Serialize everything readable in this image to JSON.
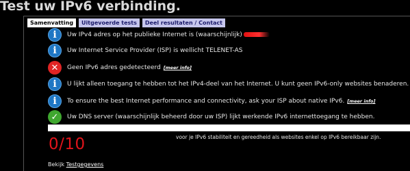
{
  "page": {
    "title": "Test uw IPv6 verbinding."
  },
  "tabs": [
    {
      "label": "Samenvatting",
      "active": true
    },
    {
      "label": "Uitgevoerde tests",
      "active": false
    },
    {
      "label": "Deel resultaten / Contact",
      "active": false
    }
  ],
  "messages": [
    {
      "icon": "info-icon",
      "text": "Uw IPv4 adres op het publieke Internet is (waarschijnlijk)"
    },
    {
      "icon": "info-icon",
      "text": "Uw Internet Service Provider (ISP) is wellicht TELENET-AS"
    },
    {
      "icon": "error-icon",
      "text": "Geen IPv6 adres gedetecteerd",
      "more": "[meer info]"
    },
    {
      "icon": "info-icon",
      "text": "U lijkt alleen toegang te hebben tot het IPv4-deel van het Internet. U kunt geen IPv6-only websites benaderen."
    },
    {
      "icon": "info-icon",
      "text": "To ensure the best Internet performance and connectivity, ask your ISP about native IPv6.",
      "more": "[meer info]"
    },
    {
      "icon": "check-icon",
      "text": "Uw DNS server (waarschijnlijk beheerd door uw ISP) lijkt werkende IPv6 internettoegang te hebben."
    }
  ],
  "score": {
    "value": "0/10",
    "note": "voor je IPv6 stabiliteit en gereedheid als websites enkel op IPv6 bereikbaar zijn."
  },
  "footer": {
    "prefix": "Bekijk",
    "link": "Testgegevens"
  },
  "colors": {
    "info": "#1f77c4",
    "error": "#e02424",
    "ok": "#3fa72f",
    "score": "#e0141b",
    "tab_active_bg": "#ffffff",
    "tab_inactive_bg": "#c6c6ec"
  }
}
